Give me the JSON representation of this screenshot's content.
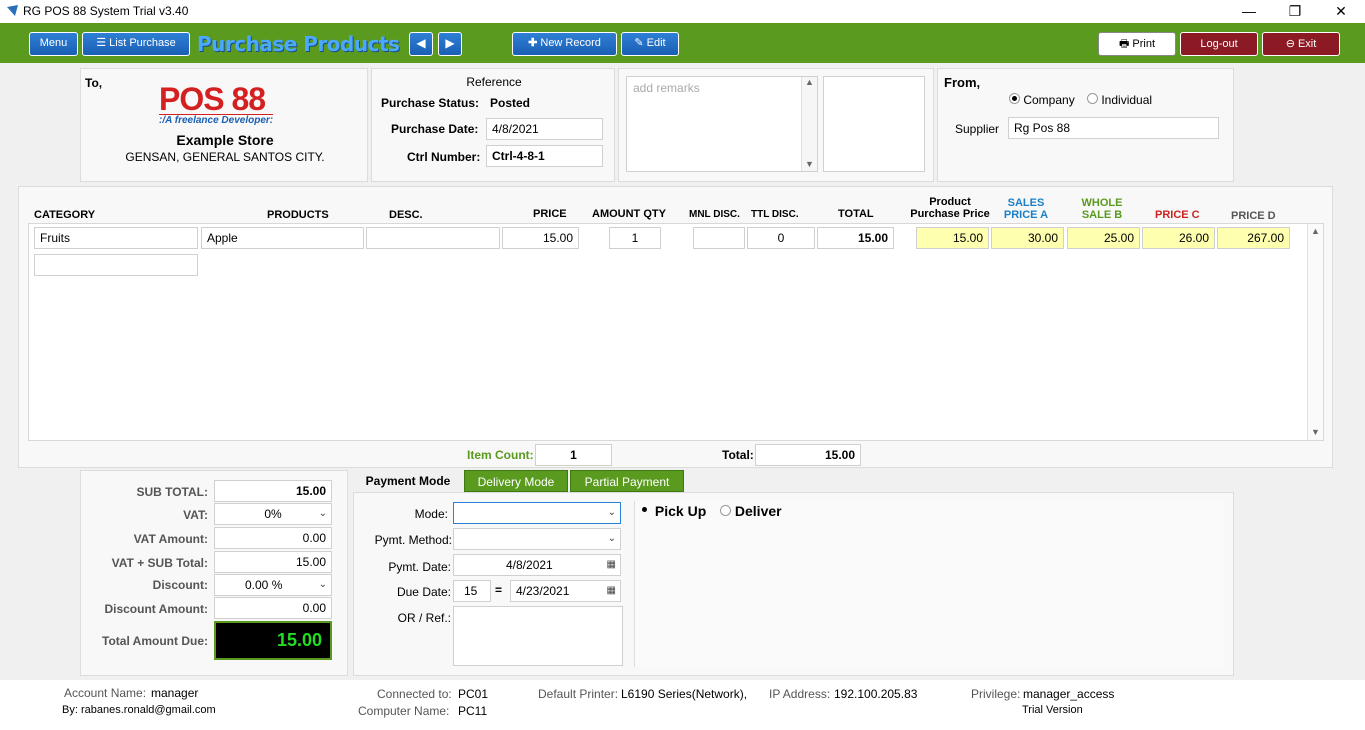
{
  "window": {
    "title": "RG POS 88 System Trial v3.40",
    "min": "—",
    "max": "❐",
    "close": "✕"
  },
  "toolbar": {
    "menu": "Menu",
    "list_purchase": "List Purchase",
    "page_title": "Purchase Products",
    "new_record": "New Record",
    "edit": "Edit",
    "print": "Print",
    "logout": "Log-out",
    "exit": "Exit"
  },
  "to": {
    "label": "To,",
    "logo_text": "POS 88",
    "logo_sub": ":/A freelance Developer:",
    "store": "Example Store",
    "address": "GENSAN, GENERAL SANTOS CITY."
  },
  "reference": {
    "title": "Reference",
    "status_label": "Purchase Status:",
    "status_value": "Posted",
    "date_label": "Purchase Date:",
    "date_value": "4/8/2021",
    "ctrl_label": "Ctrl Number:",
    "ctrl_value": "Ctrl-4-8-1"
  },
  "remarks": {
    "placeholder": "add remarks"
  },
  "from": {
    "label": "From,",
    "opt_company": "Company",
    "opt_individual": "Individual",
    "supplier_label": "Supplier",
    "supplier_value": "Rg Pos 88"
  },
  "grid": {
    "headers": {
      "category": "CATEGORY",
      "products": "PRODUCTS",
      "desc": "DESC.",
      "price": "PRICE",
      "qty": "AMOUNT QTY",
      "mnl": "MNL DISC.",
      "ttl": "TTL DISC.",
      "total": "TOTAL",
      "pp1": "Product",
      "pp2": "Purchase Price",
      "sa1": "SALES",
      "sa2": "PRICE A",
      "wb1": "WHOLE",
      "wb2": "SALE B",
      "pc": "PRICE C",
      "pd": "PRICE D"
    },
    "row": {
      "category": "Fruits",
      "product": "Apple",
      "desc": "",
      "price": "15.00",
      "qty": "1",
      "mnl": "",
      "ttl": "0",
      "total": "15.00",
      "pp": "15.00",
      "pa": "30.00",
      "pb": "25.00",
      "pc": "26.00",
      "pd": "267.00"
    },
    "item_count_label": "Item Count:",
    "item_count": "1",
    "total_label": "Total:",
    "total_value": "15.00"
  },
  "summary": {
    "sub_total_label": "SUB TOTAL:",
    "sub_total": "15.00",
    "vat_label": "VAT:",
    "vat": "0%",
    "vat_amount_label": "VAT Amount:",
    "vat_amount": "0.00",
    "vat_sub_label": "VAT + SUB Total:",
    "vat_sub": "15.00",
    "discount_label": "Discount:",
    "discount": "0.00 %",
    "discount_amount_label": "Discount Amount:",
    "discount_amount": "0.00",
    "total_due_label": "Total Amount Due:",
    "total_due": "15.00"
  },
  "payment": {
    "tab_payment": "Payment Mode",
    "tab_delivery": "Delivery Mode",
    "tab_partial": "Partial Payment",
    "mode_label": "Mode:",
    "method_label": "Pymt. Method:",
    "pdate_label": "Pymt. Date:",
    "pdate": "4/8/2021",
    "due_label": "Due Date:",
    "due_days": "15",
    "eq": "=",
    "due_date": "4/23/2021",
    "or_label": "OR / Ref.:",
    "pickup": "Pick Up",
    "deliver": "Deliver"
  },
  "status": {
    "account_label": "Account Name:",
    "account": "manager",
    "by_label": "By:",
    "by": "rabanes.ronald@gmail.com",
    "connected_label": "Connected to:",
    "connected": "PC01",
    "computer_label": "Computer Name:",
    "computer": "PC11",
    "printer_label": "Default Printer:",
    "printer": "L6190 Series(Network),",
    "ip_label": "IP Address:",
    "ip": "192.100.205.83",
    "priv_label": "Privilege:",
    "priv": "manager_access",
    "trial": "Trial Version"
  },
  "colors": {
    "toolbar": "#5a9a1e",
    "accent_blue": "#1a5fb4",
    "red": "#8b1a24",
    "sales_a": "#1a7fc4",
    "whole_b": "#5a9a1e",
    "price_c": "#cc2222",
    "due_green": "#22dd22"
  }
}
